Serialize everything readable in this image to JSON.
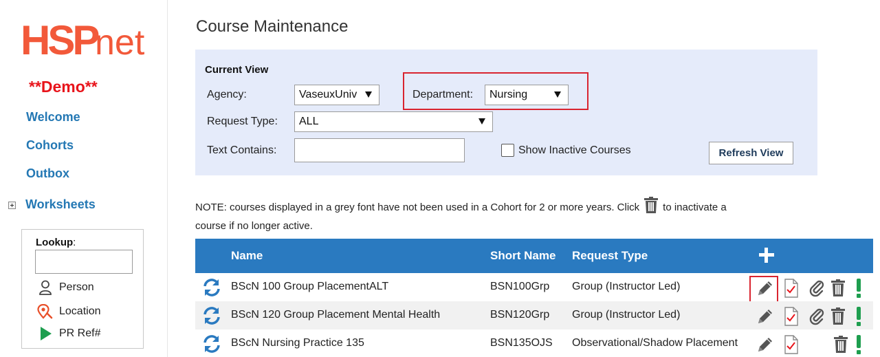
{
  "sidebar": {
    "logo": {
      "hsp": "HSP",
      "net": "net",
      "color": "#f2593a"
    },
    "demo_label": "**Demo**",
    "nav": {
      "welcome": "Welcome",
      "cohorts": "Cohorts",
      "outbox": "Outbox",
      "worksheets": "Worksheets"
    },
    "lookup": {
      "title": "Lookup",
      "colon": ":",
      "input_value": "",
      "items": {
        "person": "Person",
        "location": "Location",
        "pr_ref": "PR Ref#"
      }
    }
  },
  "page": {
    "title": "Course Maintenance",
    "current_view": {
      "title": "Current View",
      "agency_label": "Agency:",
      "agency_value": "VaseuxUniv",
      "department_label": "Department:",
      "department_value": "Nursing",
      "request_type_label": "Request Type:",
      "request_type_value": "ALL",
      "text_contains_label": "Text Contains:",
      "text_contains_value": "",
      "show_inactive_label": "Show Inactive Courses",
      "refresh_label": "Refresh View"
    },
    "note": {
      "before": "NOTE: courses displayed in a grey font have not been used in a Cohort for 2 or more years. Click",
      "after": "to inactivate a course if no longer active."
    }
  },
  "table": {
    "headers": {
      "name": "Name",
      "short_name": "Short Name",
      "request_type": "Request Type"
    },
    "rows": [
      {
        "name": "BScN 100 Group PlacementALT",
        "short_name": "BSN100Grp",
        "request_type": "Group (Instructor Led)"
      },
      {
        "name": "BScN 120 Group Placement Mental Health",
        "short_name": "BSN120Grp",
        "request_type": "Group (Instructor Led)"
      },
      {
        "name": "BScN Nursing Practice 135",
        "short_name": "BSN135OJS",
        "request_type": "Observational/Shadow Placement"
      }
    ]
  },
  "colors": {
    "nav": "#2478b4",
    "header": "#2a7ac0",
    "panel": "#e5ebfa",
    "highlight": "#d9242f",
    "demo": "#e8141b",
    "exclaim": "#1e9e4f"
  }
}
